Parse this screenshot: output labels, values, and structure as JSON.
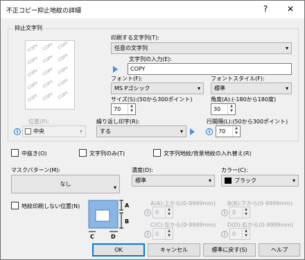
{
  "window": {
    "title": "不正コピー抑止地紋の詳細",
    "help_label": "?",
    "close_label": "✕"
  },
  "group": {
    "title": "抑止文字列",
    "preview_word": "COPY"
  },
  "print_string": {
    "label": "印刷する文字列(T):",
    "value": "任意の文字列"
  },
  "string_input": {
    "label": "文字列の入力(E):",
    "value": "COPY"
  },
  "font": {
    "label": "フォント(F):",
    "value": "MS Pゴシック"
  },
  "font_style": {
    "label": "フォントスタイル(F):",
    "value": "標準"
  },
  "size": {
    "label": "サイズ(S):(50から300ポイント)",
    "value": "70"
  },
  "angle": {
    "label": "角度(A):(-180から180度)",
    "value": "30"
  },
  "position": {
    "label": "位置(P):",
    "value": "中央"
  },
  "repeat": {
    "label": "繰り返し印字(R):",
    "value": "する"
  },
  "line_spacing": {
    "label": "行間隔(L):(50から300ポイント)",
    "value": "70"
  },
  "checkboxes": {
    "hollow": "中抜き(O)",
    "text_only": "文字列のみ(T)",
    "swap": "文字列地紋/背景地紋の入れ替え(R)"
  },
  "mask_pattern": {
    "label": "マスクパターン(M):",
    "value": "なし"
  },
  "density": {
    "label": "濃度(D):",
    "value": "標準"
  },
  "color": {
    "label": "カラー(C):",
    "value": "ブラック"
  },
  "no_print_area": {
    "label": "地紋印刷しない位置(N)",
    "top": {
      "label": "A(A):上から(0-9999mm)",
      "value": "0"
    },
    "bottom": {
      "label": "B(B):下から(0-9999mm)",
      "value": "0"
    },
    "left": {
      "label": "C(C):左から(0-9999mm)",
      "value": "0"
    },
    "right": {
      "label": "D(D):右から(0-9999mm)",
      "value": "0"
    },
    "diagram_labels": {
      "a": "A",
      "b": "B",
      "c": "C",
      "d": "D"
    }
  },
  "buttons": {
    "ok": "OK",
    "cancel": "キャンセル",
    "reset": "標準に戻す(S)",
    "help": "ヘルプ"
  }
}
